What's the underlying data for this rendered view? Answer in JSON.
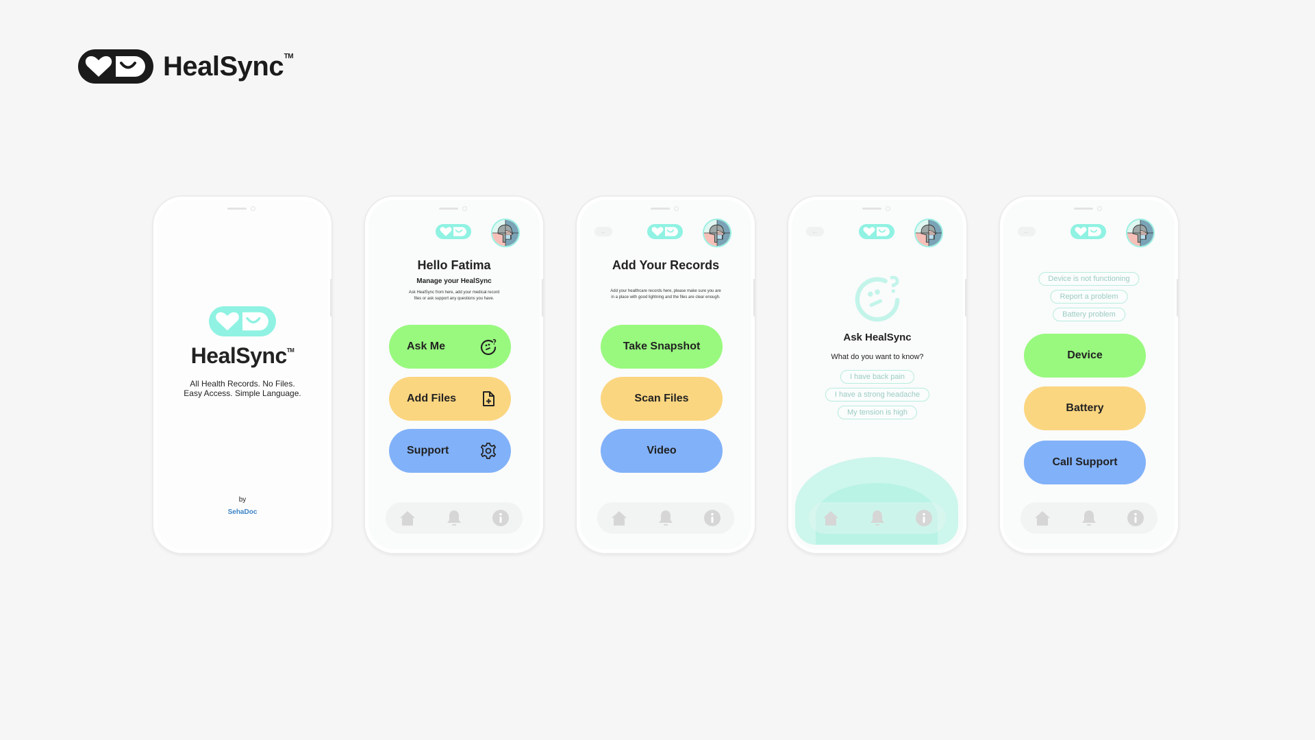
{
  "brand": {
    "name": "HealSync",
    "trademark": "TM"
  },
  "colors": {
    "mint": "#8ff2e2",
    "green": "#98f97e",
    "yellow": "#fbd680",
    "blue": "#81b1f9",
    "text": "#222222",
    "link": "#3d84c7"
  },
  "splash": {
    "title": "HealSync",
    "trademark": "TM",
    "tagline_1": "All Health Records. No Files.",
    "tagline_2": "Easy Access. Simple Language.",
    "by": "by",
    "company": "SehaDoc"
  },
  "home": {
    "title": "Hello Fatima",
    "subtitle": "Manage your HealSync",
    "description_1": "Ask HealSync from here, add your medical record",
    "description_2": "files or ask support any questions you have.",
    "buttons": [
      {
        "label": "Ask Me",
        "icon": "thinking-face-icon"
      },
      {
        "label": "Add Files",
        "icon": "file-add-icon"
      },
      {
        "label": "Support",
        "icon": "gear-icon"
      }
    ]
  },
  "records": {
    "title": "Add Your Records",
    "description_1": "Add your healthcare records here, please make sure you are",
    "description_2": "in a place with good lightning and the files are clear enough.",
    "buttons": [
      {
        "label": "Take Snapshot"
      },
      {
        "label": "Scan Files"
      },
      {
        "label": "Video"
      }
    ]
  },
  "ask": {
    "title": "Ask HealSync",
    "subtitle": "What do you want to know?",
    "suggestions": [
      "I have back pain",
      "I have a strong headache",
      "My tension is high"
    ]
  },
  "support": {
    "suggestions": [
      "Device is not functioning",
      "Report a problem",
      "Battery problem"
    ],
    "buttons": [
      {
        "label": "Device"
      },
      {
        "label": "Battery"
      },
      {
        "label": "Call Support"
      }
    ]
  },
  "nav": {
    "items": [
      "home-icon",
      "bell-icon",
      "info-icon"
    ],
    "back_icon": "arrow-left-icon"
  }
}
